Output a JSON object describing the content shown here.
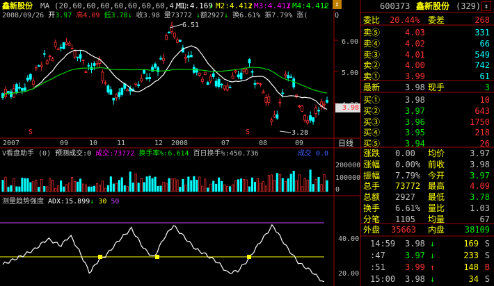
{
  "stock_name": "鑫新股份",
  "ma_label": "MA (20,60,60,60,60,60,60,60,4,1)",
  "ma_values": [
    {
      "label": "M1:4.169",
      "color": "#ffffff"
    },
    {
      "label": "M2:4.412",
      "color": "#ffff00"
    },
    {
      "label": "M3:4.412",
      "color": "#ff00ff"
    },
    {
      "label": "M4:4.412",
      "color": "#00ff00"
    }
  ],
  "ohlc_row": {
    "date": "2008/09/26",
    "open_label": "开",
    "open": "3.97",
    "high_label": "高",
    "high": "4.09",
    "low_label": "低",
    "low": "3.78",
    "close_label": "收",
    "close": "3.98",
    "volume_label": "量",
    "volume": "73772",
    "amount_label": "额",
    "amount": "2927",
    "turnover_label": "换",
    "turnover": "6.61%",
    "amplitude_label": "振",
    "amplitude": "7.79%",
    "change_label": "涨",
    "change_tail": "(",
    "extra_tail": "Q"
  },
  "price_axis": {
    "ticks": [
      "6.00",
      "5.00",
      "4.00"
    ]
  },
  "marks": {
    "high": "6.51",
    "low": "3.28",
    "current_price": "3.98"
  },
  "time_axis": {
    "labels": [
      "2007",
      "09",
      "10",
      "11",
      "12",
      "2008",
      "07",
      "08",
      "09"
    ],
    "period": "日线"
  },
  "dividend_mark": "S",
  "volume_panel": {
    "title": "V看盘助手 (0)",
    "predict_label": "预测成交:0",
    "deal_label": "成交:73772",
    "turnover_label": "换手率%:6.614",
    "hundred_label": "百日换手%:450.736",
    "tail_label": "成交 0.0",
    "axis_ticks": [
      "200000",
      "100000",
      "0"
    ]
  },
  "adx_panel": {
    "title": "测量趋势强度",
    "adx_label": "ADX:15.899",
    "level1": "30",
    "level2": "50",
    "axis_ticks": [
      "40.00",
      "20.00"
    ]
  },
  "quote": {
    "code": "600373",
    "name": "鑫新股份",
    "count": "(329)",
    "weibi_label": "委比",
    "weibi": "20.44%",
    "weicha_label": "委差",
    "weicha": "268",
    "asks": [
      {
        "label": "卖⑤",
        "price": "4.03",
        "vol": "331"
      },
      {
        "label": "卖④",
        "price": "4.02",
        "vol": "66"
      },
      {
        "label": "卖③",
        "price": "4.01",
        "vol": "549"
      },
      {
        "label": "卖②",
        "price": "4.00",
        "vol": "742"
      },
      {
        "label": "卖①",
        "price": "3.99",
        "vol": "61"
      }
    ],
    "last_label": "最新",
    "last": "3.98",
    "xianshou_label": "现手",
    "xianshou": "3",
    "bids": [
      {
        "label": "买①",
        "price": "3.98",
        "vol": "10"
      },
      {
        "label": "买②",
        "price": "3.97",
        "vol": "643"
      },
      {
        "label": "买③",
        "price": "3.96",
        "vol": "1750"
      },
      {
        "label": "买④",
        "price": "3.95",
        "vol": "218"
      },
      {
        "label": "买⑤",
        "price": "3.94",
        "vol": "26"
      }
    ],
    "stats": [
      {
        "l1": "涨跌",
        "v1": "0.00",
        "c1": "#c0c0c0",
        "l2": "均价",
        "v2": "3.97",
        "c2": "#c0c0c0"
      },
      {
        "l1": "涨幅",
        "v1": "0.00%",
        "c1": "#c0c0c0",
        "l2": "前收",
        "v2": "3.98",
        "c2": "#c0c0c0"
      },
      {
        "l1": "振幅",
        "v1": "7.79%",
        "c1": "#c0c0c0",
        "l2": "今开",
        "v2": "3.97",
        "c2": "#00e600"
      },
      {
        "l1": "总手",
        "v1": "73772",
        "c1": "#ffff00",
        "l2": "最高",
        "v2": "4.09",
        "c2": "#ff3232"
      },
      {
        "l1": "总额",
        "v1": "2927",
        "c1": "#c0c0c0",
        "l2": "最低",
        "v2": "3.78",
        "c2": "#00e600"
      },
      {
        "l1": "换手",
        "v1": "6.61%",
        "c1": "#c0c0c0",
        "l2": "量比",
        "v2": "1.03",
        "c2": "#c0c0c0"
      },
      {
        "l1": "分笔",
        "v1": "1105",
        "c1": "#c0c0c0",
        "l2": "均量",
        "v2": "67",
        "c2": "#c0c0c0"
      }
    ],
    "waipan_label": "外盘",
    "waipan": "35663",
    "neipan_label": "内盘",
    "neipan": "38109",
    "ticks": [
      {
        "time": "14:59",
        "price": "3.98",
        "arrow": "↓",
        "pcolor": "#c0c0c0",
        "acolor": "#00e600",
        "vol": "169",
        "bs": "S"
      },
      {
        "time": ":47",
        "price": "3.97",
        "arrow": "↓",
        "pcolor": "#00e600",
        "acolor": "#00e600",
        "vol": "233",
        "bs": "S"
      },
      {
        "time": ":51",
        "price": "3.99",
        "arrow": "↑",
        "pcolor": "#ff3232",
        "acolor": "#ff3232",
        "vol": "148",
        "bs": "B"
      },
      {
        "time": "15:00",
        "price": "3.98",
        "arrow": "↓",
        "pcolor": "#c0c0c0",
        "acolor": "#00e600",
        "vol": "34",
        "bs": "S"
      }
    ]
  },
  "colors": {
    "up": "#ff3232",
    "down": "#00ffff",
    "ma_white": "#ffffff",
    "ma_green": "#00d000",
    "border": "#a00000",
    "adx_line": "#ffffff",
    "adx_level30": "#ffff00",
    "adx_level50": "#cc44ff"
  }
}
